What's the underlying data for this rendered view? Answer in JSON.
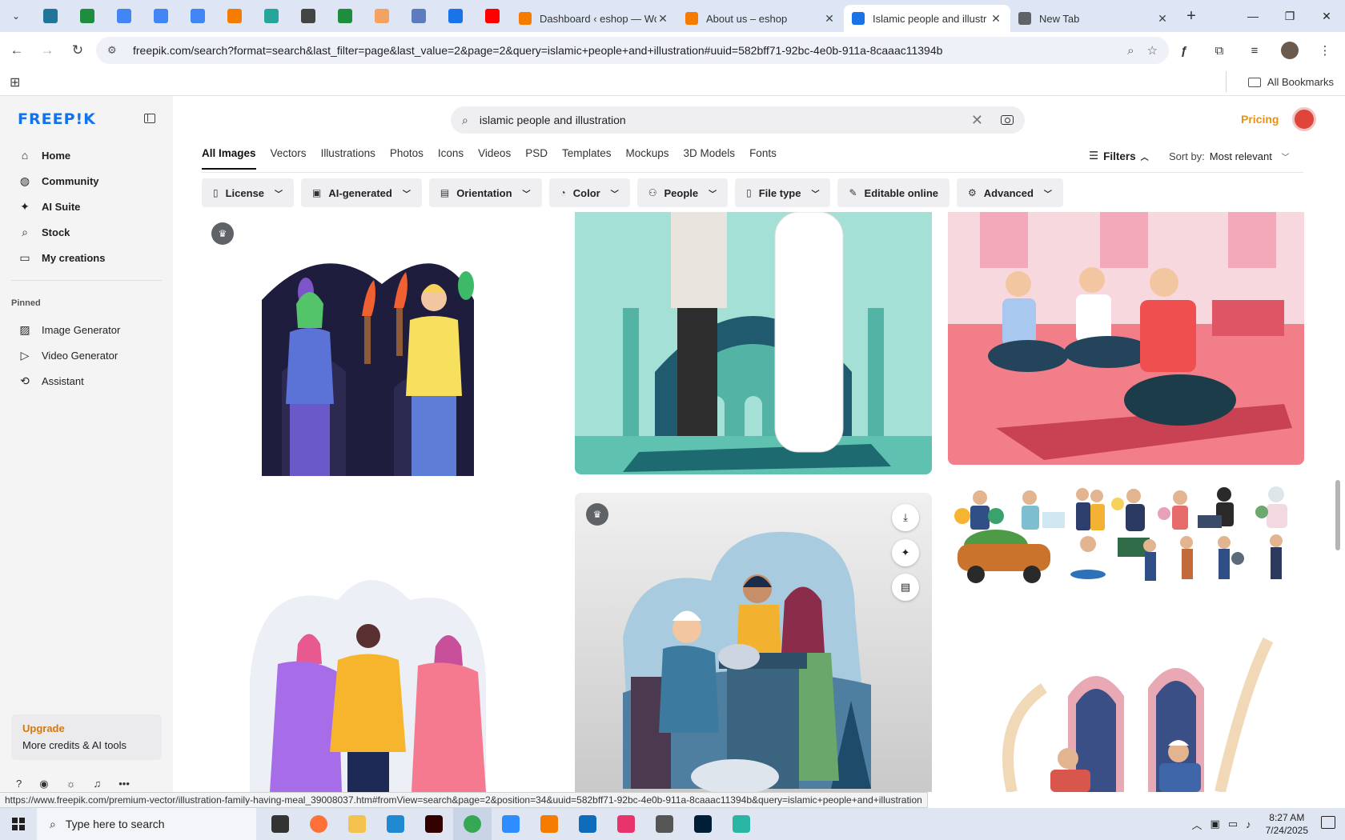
{
  "browser": {
    "pinned_tabs": [
      {
        "icon": "wordpress-icon",
        "color": "#21759b"
      },
      {
        "icon": "sheets-icon",
        "color": "#1e8e3e"
      },
      {
        "icon": "docs-icon",
        "color": "#4285f4"
      },
      {
        "icon": "docs-icon",
        "color": "#4285f4"
      },
      {
        "icon": "docs-icon",
        "color": "#4285f4"
      },
      {
        "icon": "xampp-icon",
        "color": "#f57c00"
      },
      {
        "icon": "app-icon",
        "color": "#26a69a"
      },
      {
        "icon": "openai-icon",
        "color": "#444444"
      },
      {
        "icon": "sheets-icon",
        "color": "#1e8e3e"
      },
      {
        "icon": "app-icon",
        "color": "#f4a261"
      },
      {
        "icon": "app-icon",
        "color": "#5c7cbe"
      },
      {
        "icon": "forms-icon",
        "color": "#1a73e8"
      },
      {
        "icon": "youtube-icon",
        "color": "#ff0000"
      }
    ],
    "tabs": [
      {
        "title": "Dashboard ‹ eshop — Wo",
        "fav_color": "#f57c00",
        "active": false
      },
      {
        "title": "About us – eshop",
        "fav_color": "#f57c00",
        "active": false
      },
      {
        "title": "Islamic people and illustr",
        "fav_color": "#1a73e8",
        "active": true
      },
      {
        "title": "New Tab",
        "fav_color": "#5f6368",
        "active": false
      }
    ],
    "url": "freepik.com/search?format=search&last_filter=page&last_value=2&page=2&query=islamic+people+and+illustration#uuid=582bff71-92bc-4e0b-911a-8caaac11394b",
    "all_bookmarks": "All Bookmarks",
    "status_url": "https://www.freepik.com/premium-vector/illustration-family-having-meal_39008037.htm#fromView=search&page=2&position=34&uuid=582bff71-92bc-4e0b-911a-8caaac11394b&query=islamic+people+and+illustration"
  },
  "sidebar": {
    "logo": "FREEP!K",
    "nav": [
      {
        "label": "Home",
        "icon": "home-icon",
        "glyph": "⌂"
      },
      {
        "label": "Community",
        "icon": "globe-icon",
        "glyph": "◍"
      },
      {
        "label": "AI Suite",
        "icon": "sparkle-icon",
        "glyph": "✦"
      },
      {
        "label": "Stock",
        "icon": "search-icon",
        "glyph": "⌕"
      },
      {
        "label": "My creations",
        "icon": "folder-icon",
        "glyph": "▭"
      }
    ],
    "pinned_label": "Pinned",
    "pinned": [
      {
        "label": "Image Generator",
        "icon": "image-icon",
        "glyph": "▨"
      },
      {
        "label": "Video Generator",
        "icon": "video-icon",
        "glyph": "▷"
      },
      {
        "label": "Assistant",
        "icon": "assistant-icon",
        "glyph": "⟲"
      }
    ],
    "upgrade_title": "Upgrade",
    "upgrade_sub": "More credits & AI tools"
  },
  "search": {
    "query": "islamic people and illustration"
  },
  "header": {
    "pricing": "Pricing"
  },
  "types": [
    "All Images",
    "Vectors",
    "Illustrations",
    "Photos",
    "Icons",
    "Videos",
    "PSD",
    "Templates",
    "Mockups",
    "3D Models",
    "Fonts"
  ],
  "filters_label": "Filters",
  "sort": {
    "label": "Sort by:",
    "value": "Most relevant"
  },
  "chips": [
    {
      "label": "License",
      "icon": "license-icon",
      "glyph": "▯"
    },
    {
      "label": "AI-generated",
      "icon": "ai-icon",
      "glyph": "▣"
    },
    {
      "label": "Orientation",
      "icon": "orientation-icon",
      "glyph": "▤"
    },
    {
      "label": "Color",
      "icon": "color-icon",
      "glyph": "◔"
    },
    {
      "label": "People",
      "icon": "people-icon",
      "glyph": "⚇"
    },
    {
      "label": "File type",
      "icon": "file-icon",
      "glyph": "▯"
    },
    {
      "label": "Editable online",
      "icon": "pencil-icon",
      "glyph": "✎",
      "no_caret": true
    },
    {
      "label": "Advanced",
      "icon": "gear-icon",
      "glyph": "⚙"
    }
  ],
  "taskbar": {
    "search_placeholder": "Type here to search",
    "time": "8:27 AM",
    "date": "7/24/2025",
    "apps": [
      {
        "name": "taskview-icon",
        "color": "#333333"
      },
      {
        "name": "firefox-icon",
        "color": "#ff7139"
      },
      {
        "name": "explorer-icon",
        "color": "#f2c14e"
      },
      {
        "name": "vscode-icon",
        "color": "#1f8ad2"
      },
      {
        "name": "illustrator-icon",
        "color": "#330000"
      },
      {
        "name": "chrome-icon",
        "color": "#34a853",
        "active": true
      },
      {
        "name": "zoom-icon",
        "color": "#2d8cff"
      },
      {
        "name": "xampp-icon",
        "color": "#f57c00"
      },
      {
        "name": "outlook-icon",
        "color": "#0f6cbd"
      },
      {
        "name": "creative-cloud-icon",
        "color": "#e8336b"
      },
      {
        "name": "pen-icon",
        "color": "#555555"
      },
      {
        "name": "photoshop-icon",
        "color": "#001e36"
      },
      {
        "name": "app-icon",
        "color": "#2bb5a4"
      }
    ]
  }
}
